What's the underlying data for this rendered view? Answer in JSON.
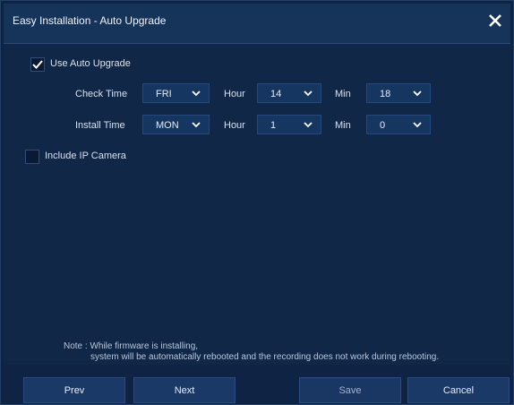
{
  "window": {
    "title": "Easy Installation - Auto Upgrade"
  },
  "settings": {
    "use_auto_upgrade": {
      "label": "Use Auto Upgrade",
      "checked": true
    },
    "check_time": {
      "label": "Check Time",
      "day": "FRI",
      "hour_label": "Hour",
      "hour": "14",
      "min_label": "Min",
      "min": "18"
    },
    "install_time": {
      "label": "Install Time",
      "day": "MON",
      "hour_label": "Hour",
      "hour": "1",
      "min_label": "Min",
      "min": "0"
    },
    "include_ip_camera": {
      "label": "Include IP Camera",
      "checked": false
    }
  },
  "note": {
    "line1": "Note : While firmware is installing,",
    "line2": "system will be automatically rebooted and the recording does not work during rebooting."
  },
  "buttons": {
    "prev": "Prev",
    "next": "Next",
    "save": "Save",
    "cancel": "Cancel"
  }
}
